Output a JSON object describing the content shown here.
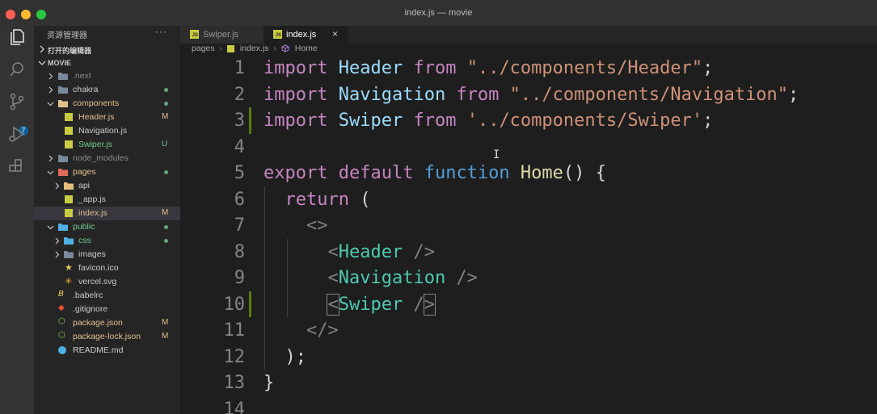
{
  "window": {
    "title": "index.js — movie"
  },
  "activity_bar": {
    "icons": [
      "files-icon",
      "search-icon",
      "source-control-icon",
      "run-debug-icon",
      "extensions-icon"
    ],
    "scm_badge": "7"
  },
  "sidebar": {
    "header": "资源管理器",
    "more": "···",
    "open_editors": "打开的编辑器",
    "project": "MOVIE",
    "tree": [
      {
        "name": ".next",
        "type": "folder",
        "depth": 1,
        "expanded": false,
        "color": "#8c8c8c",
        "status": ""
      },
      {
        "name": "chakra",
        "type": "folder",
        "depth": 1,
        "expanded": false,
        "color": "#cccccc",
        "status": "dot"
      },
      {
        "name": "components",
        "type": "folder",
        "depth": 1,
        "expanded": true,
        "color": "#e2c08d",
        "status": "dot"
      },
      {
        "name": "Header.js",
        "type": "js",
        "depth": 2,
        "color": "#e2c08d",
        "status": "M"
      },
      {
        "name": "Navigation.js",
        "type": "js",
        "depth": 2,
        "color": "#cccccc",
        "status": ""
      },
      {
        "name": "Swiper.js",
        "type": "js",
        "depth": 2,
        "color": "#73c991",
        "status": "U"
      },
      {
        "name": "node_modules",
        "type": "folder",
        "depth": 1,
        "expanded": false,
        "color": "#8c8c8c",
        "status": ""
      },
      {
        "name": "pages",
        "type": "folder",
        "depth": 1,
        "expanded": true,
        "color": "#e2c08d",
        "status": "dot"
      },
      {
        "name": "api",
        "type": "folder",
        "depth": 2,
        "expanded": false,
        "color": "#cccccc",
        "status": ""
      },
      {
        "name": "_app.js",
        "type": "js",
        "depth": 2,
        "color": "#cccccc",
        "status": ""
      },
      {
        "name": "index.js",
        "type": "js",
        "depth": 2,
        "color": "#e2c08d",
        "status": "M",
        "selected": true
      },
      {
        "name": "public",
        "type": "folder",
        "depth": 1,
        "expanded": true,
        "color": "#73c991",
        "status": "dot"
      },
      {
        "name": "css",
        "type": "folder",
        "depth": 2,
        "expanded": false,
        "color": "#73c991",
        "status": "dot"
      },
      {
        "name": "images",
        "type": "folder",
        "depth": 2,
        "expanded": false,
        "color": "#cccccc",
        "status": ""
      },
      {
        "name": "favicon.ico",
        "type": "star",
        "depth": 2,
        "color": "#cccccc",
        "status": ""
      },
      {
        "name": "vercel.svg",
        "type": "svg",
        "depth": 2,
        "color": "#cccccc",
        "status": ""
      },
      {
        "name": ".babelrc",
        "type": "babel",
        "depth": 1,
        "color": "#cccccc",
        "status": ""
      },
      {
        "name": ".gitignore",
        "type": "git",
        "depth": 1,
        "color": "#cccccc",
        "status": ""
      },
      {
        "name": "package.json",
        "type": "node",
        "depth": 1,
        "color": "#e2c08d",
        "status": "M"
      },
      {
        "name": "package-lock.json",
        "type": "node",
        "depth": 1,
        "color": "#e2c08d",
        "status": "M"
      },
      {
        "name": "README.md",
        "type": "info",
        "depth": 1,
        "color": "#cccccc",
        "status": ""
      }
    ]
  },
  "tabs": [
    {
      "label": "Swiper.js",
      "active": false
    },
    {
      "label": "index.js",
      "active": true,
      "close": "×"
    }
  ],
  "breadcrumb": {
    "folder": "pages",
    "file": "index.js",
    "symbol": "Home"
  },
  "code": {
    "lines": [
      {
        "n": "1",
        "tokens": [
          [
            "kw",
            "import"
          ],
          [
            "p",
            " "
          ],
          [
            "var",
            "Header"
          ],
          [
            "p",
            " "
          ],
          [
            "kw",
            "from"
          ],
          [
            "p",
            " "
          ],
          [
            "str",
            "\"../components/Header\""
          ],
          [
            "p",
            ";"
          ]
        ]
      },
      {
        "n": "2",
        "tokens": [
          [
            "kw",
            "import"
          ],
          [
            "p",
            " "
          ],
          [
            "var",
            "Navigation"
          ],
          [
            "p",
            " "
          ],
          [
            "kw",
            "from"
          ],
          [
            "p",
            " "
          ],
          [
            "str",
            "\"../components/Navigation\""
          ],
          [
            "p",
            ";"
          ]
        ]
      },
      {
        "n": "3",
        "git": true,
        "tokens": [
          [
            "kw",
            "import"
          ],
          [
            "p",
            " "
          ],
          [
            "var",
            "Swiper"
          ],
          [
            "p",
            " "
          ],
          [
            "kw",
            "from"
          ],
          [
            "p",
            " "
          ],
          [
            "str",
            "'../components/Swiper'"
          ],
          [
            "p",
            ";"
          ]
        ]
      },
      {
        "n": "4",
        "tokens": []
      },
      {
        "n": "5",
        "tokens": [
          [
            "kw",
            "export"
          ],
          [
            "p",
            " "
          ],
          [
            "kw",
            "default"
          ],
          [
            "p",
            " "
          ],
          [
            "blue",
            "function"
          ],
          [
            "p",
            " "
          ],
          [
            "fn",
            "Home"
          ],
          [
            "p",
            "() {"
          ]
        ]
      },
      {
        "n": "6",
        "tokens": [
          [
            "p",
            "  "
          ],
          [
            "kw",
            "return"
          ],
          [
            "p",
            " ("
          ]
        ]
      },
      {
        "n": "7",
        "tokens": [
          [
            "p",
            "    "
          ],
          [
            "br",
            "<>"
          ]
        ]
      },
      {
        "n": "8",
        "tokens": [
          [
            "p",
            "      "
          ],
          [
            "br",
            "<"
          ],
          [
            "tag",
            "Header"
          ],
          [
            "p",
            " "
          ],
          [
            "br",
            "/>"
          ]
        ]
      },
      {
        "n": "9",
        "tokens": [
          [
            "p",
            "      "
          ],
          [
            "br",
            "<"
          ],
          [
            "tag",
            "Navigation"
          ],
          [
            "p",
            " "
          ],
          [
            "br",
            "/>"
          ]
        ]
      },
      {
        "n": "10",
        "git": true,
        "tokens": [
          [
            "p",
            "      "
          ],
          [
            "brhl",
            "<"
          ],
          [
            "tag",
            "Swiper"
          ],
          [
            "p",
            " "
          ],
          [
            "br",
            "/"
          ],
          [
            "brhl",
            ">"
          ]
        ]
      },
      {
        "n": "11",
        "tokens": [
          [
            "p",
            "    "
          ],
          [
            "br",
            "</>"
          ]
        ]
      },
      {
        "n": "12",
        "tokens": [
          [
            "p",
            "  );"
          ]
        ]
      },
      {
        "n": "13",
        "tokens": [
          [
            "p",
            "}"
          ]
        ]
      },
      {
        "n": "14",
        "tokens": []
      }
    ],
    "cursor_glyph": "I"
  },
  "colors": {
    "keyword": "#c586c0",
    "string": "#ce9178",
    "identifier": "#9cdcfe",
    "tag": "#4ec9b0",
    "function": "#dcdcaa",
    "git_added": "#587c0c"
  }
}
